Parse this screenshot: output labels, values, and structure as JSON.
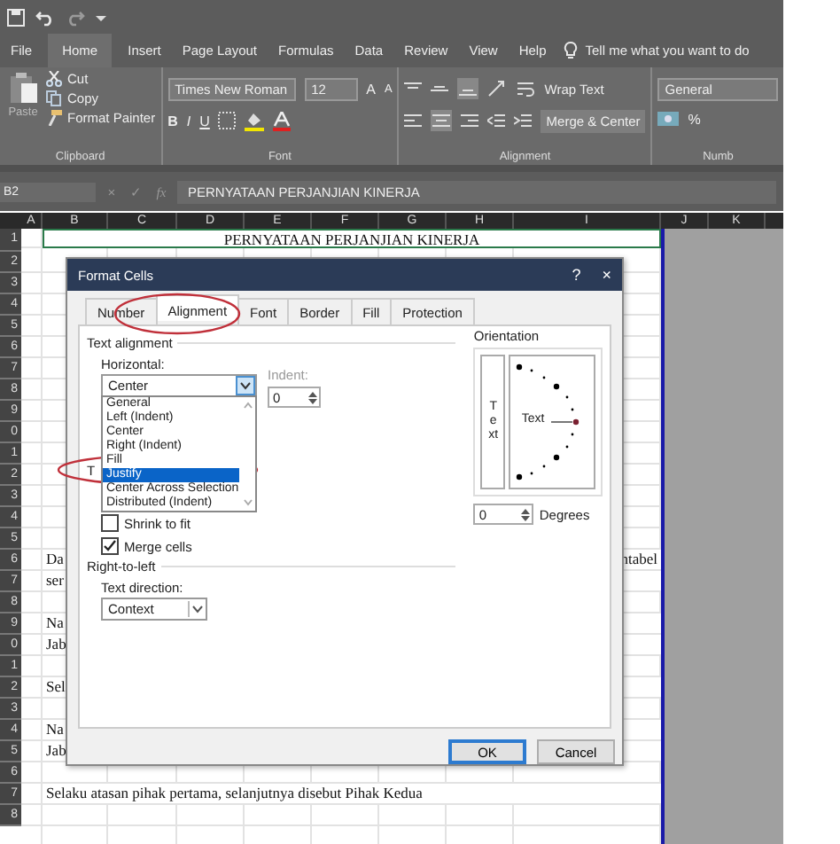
{
  "ribbon_tabs": [
    {
      "label": "File",
      "selected": false
    },
    {
      "label": "Home",
      "selected": true
    },
    {
      "label": "Insert",
      "selected": false
    },
    {
      "label": "Page Layout",
      "selected": false
    },
    {
      "label": "Formulas",
      "selected": false
    },
    {
      "label": "Data",
      "selected": false
    },
    {
      "label": "Review",
      "selected": false
    },
    {
      "label": "View",
      "selected": false
    },
    {
      "label": "Help",
      "selected": false
    }
  ],
  "tell_me": "Tell me what you want to do",
  "clipboard": {
    "paste": "Paste",
    "cut": "Cut",
    "copy": "Copy",
    "format_painter": "Format Painter",
    "group": "Clipboard"
  },
  "font": {
    "name": "Times New Roman",
    "size": "12",
    "grow": "A",
    "shrink": "A",
    "bold": "B",
    "italic": "I",
    "underline": "U",
    "group": "Font"
  },
  "alignment": {
    "wrap_text": "Wrap Text",
    "merge": "Merge & Center",
    "group": "Alignment"
  },
  "number": {
    "format": "General",
    "percent": "%",
    "group": "Numb"
  },
  "formula_bar": {
    "name_box": "B2",
    "cancel": "×",
    "enter": "✓",
    "fx": "fx",
    "formula": "PERNYATAAN PERJANJIAN KINERJA"
  },
  "sheet": {
    "columns": [
      "A",
      "B",
      "C",
      "D",
      "E",
      "F",
      "G",
      "H",
      "I",
      "J",
      "K"
    ],
    "rows": [
      {
        "header": "1",
        "merged": true,
        "cells": {
          "B": "PERNYATAAN PERJANJIAN KINERJA"
        }
      },
      {
        "header": "2"
      },
      {
        "header": "3"
      },
      {
        "header": "4"
      },
      {
        "header": "5"
      },
      {
        "header": "6"
      },
      {
        "header": "7"
      },
      {
        "header": "8"
      },
      {
        "header": "9"
      },
      {
        "header": "0"
      },
      {
        "header": "1"
      },
      {
        "header": "2"
      },
      {
        "header": "3"
      },
      {
        "header": "4"
      },
      {
        "header": "5"
      },
      {
        "header": "6",
        "cells": {
          "B": "Da",
          "I": "ntabel"
        }
      },
      {
        "header": "7",
        "cells": {
          "B": "ser"
        }
      },
      {
        "header": "8"
      },
      {
        "header": "9",
        "cells": {
          "B": "Na"
        }
      },
      {
        "header": "0",
        "cells": {
          "B": "Jab"
        }
      },
      {
        "header": "1"
      },
      {
        "header": "2",
        "cells": {
          "B": "Sel"
        }
      },
      {
        "header": "3"
      },
      {
        "header": "4",
        "cells": {
          "B": "Na"
        }
      },
      {
        "header": "5",
        "cells": {
          "B": "Jab"
        }
      },
      {
        "header": "6"
      },
      {
        "header": "7",
        "cells": {
          "B": "Selaku atasan pihak pertama, selanjutnya disebut Pihak Kedua"
        }
      },
      {
        "header": "8"
      }
    ]
  },
  "dialog": {
    "title": "Format Cells",
    "help": "?",
    "close": "×",
    "tabs": [
      {
        "label": "Number",
        "selected": false
      },
      {
        "label": "Alignment",
        "selected": true
      },
      {
        "label": "Font",
        "selected": false
      },
      {
        "label": "Border",
        "selected": false
      },
      {
        "label": "Fill",
        "selected": false
      },
      {
        "label": "Protection",
        "selected": false
      }
    ],
    "text_alignment": "Text alignment",
    "horizontal_label": "Horizontal:",
    "horizontal_value": "Center",
    "horizontal_options": [
      {
        "label": "General",
        "selected": false
      },
      {
        "label": "Left (Indent)",
        "selected": false
      },
      {
        "label": "Center",
        "selected": false
      },
      {
        "label": "Right (Indent)",
        "selected": false
      },
      {
        "label": "Fill",
        "selected": false
      },
      {
        "label": "Justify",
        "selected": true
      },
      {
        "label": "Center Across Selection",
        "selected": false
      },
      {
        "label": "Distributed (Indent)",
        "selected": false
      }
    ],
    "indent_label": "Indent:",
    "indent_value": "0",
    "covered_label": "T",
    "checks": [
      {
        "label": "Shrink to fit",
        "checked": false
      },
      {
        "label": "Merge cells",
        "checked": true
      }
    ],
    "right_to_left": "Right-to-left",
    "text_direction_label": "Text direction:",
    "text_direction_value": "Context",
    "orientation": "Orientation",
    "vertical_text": "Text",
    "dial_text": "Text",
    "degrees_value": "0",
    "degrees_label": "Degrees",
    "buttons": [
      {
        "label": "OK",
        "default": true
      },
      {
        "label": "Cancel",
        "default": false
      }
    ]
  }
}
